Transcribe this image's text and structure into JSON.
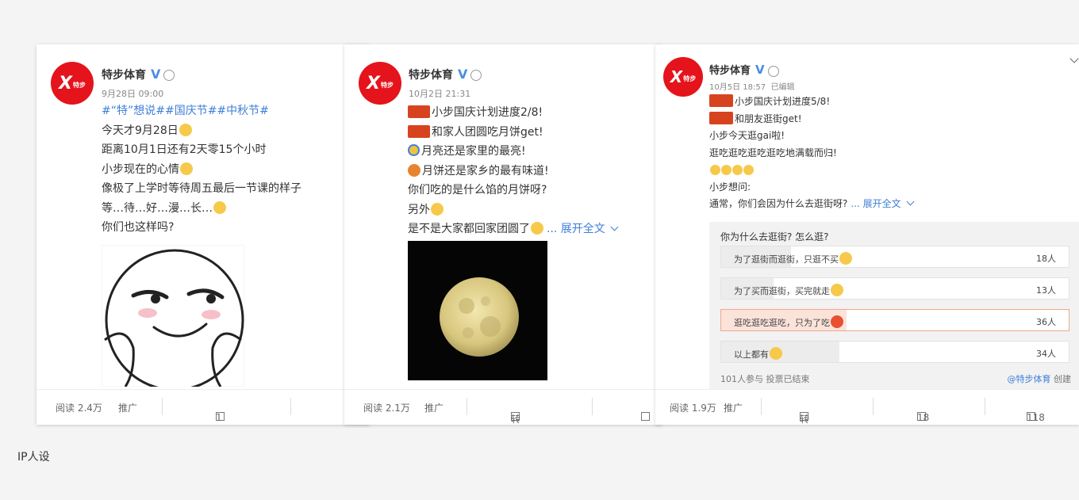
{
  "posts": [
    {
      "user": "特步体育",
      "time": "9月28日 09:00",
      "lines": [
        "#“特”想说##国庆节##中秋节#",
        "今天才9月28日",
        "距离10月1日还有2天零15个小时",
        "小步现在的心情",
        "像极了上学时等待周五最后一节课的样子",
        "等…待…好…漫…长…",
        "你们也这样吗?"
      ],
      "footer": {
        "reads": "阅读 2.4万",
        "promote": "推广",
        "share": "1"
      }
    },
    {
      "user": "特步体育",
      "time": "10月2日 21:31",
      "lines": [
        "小步国庆计划进度2/8!",
        "和家人团圆吃月饼get!",
        "月亮还是家里的最亮!",
        "月饼还是家乡的最有味道!",
        "你们吃的是什么馅的月饼呀?",
        "另外",
        "是不是大家都回家团圆了"
      ],
      "more": "... 展开全文",
      "footer": {
        "reads": "阅读 2.1万",
        "promote": "推广",
        "share": "转发"
      }
    },
    {
      "user": "特步体育",
      "time": "10月5日 18:57",
      "edited": "已编辑",
      "lines": [
        "小步国庆计划进度5/8!",
        "和朋友逛街get!",
        "小步今天逛gai啦!",
        "逛吃逛吃逛吃逛吃地满载而归!",
        "",
        "小步想问:",
        "通常，你们会因为什么去逛街呀?"
      ],
      "more": "... 展开全文",
      "poll": {
        "question": "你为什么去逛街? 怎么逛?",
        "options": [
          {
            "label": "为了逛街而逛街，只逛不买",
            "count": "18人",
            "share": 0.2
          },
          {
            "label": "为了买而逛街，买完就走",
            "count": "13人",
            "share": 0.15
          },
          {
            "label": "逛吃逛吃逛吃，只为了吃",
            "count": "36人",
            "share": 0.36
          },
          {
            "label": "以上都有",
            "count": "34人",
            "share": 0.34
          }
        ],
        "summary": "101人参与 投票已结束",
        "creator": "@特步体育",
        "created": "创建"
      },
      "footer": {
        "reads": "阅读 1.9万",
        "promote": "推广",
        "share": "转发",
        "comments": "18",
        "likes": "118"
      }
    }
  ],
  "caption": "IP人设",
  "avatar_text": "X"
}
